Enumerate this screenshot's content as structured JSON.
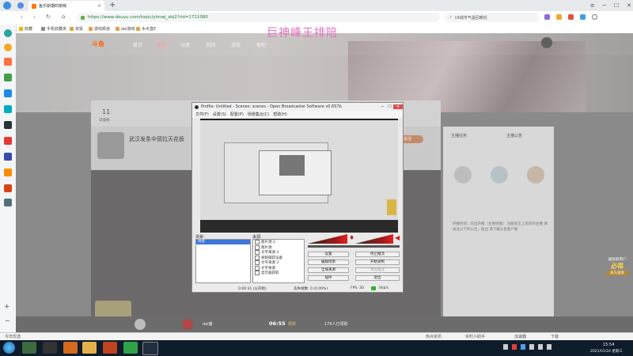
{
  "browser": {
    "tab_title": "鱼乐斯珊四弟喊",
    "new_tab": "+",
    "url": "https://www.douyu.com/topic/ylmwj_zbj2?rid=1711080",
    "search_placeholder": "19城市气温回暖低",
    "bookmarks": [
      "收藏",
      "手机收藏夹",
      "资投",
      "游戏频道",
      "dal游戏",
      "木木直E"
    ]
  },
  "overlay_banner": "巨神峰王排陪",
  "site": {
    "logo": "斗鱼",
    "nav": [
      "首页",
      "直播",
      "分类",
      "视频",
      "游戏",
      "鱼吧"
    ],
    "room": {
      "rank_label": "11",
      "rank_sub": "日排榜",
      "streamer_title": "武汉发条伞德拉天花板",
      "follow": "关注",
      "report": "举报",
      "right_tags": [
        "主播任务",
        "主播公告"
      ],
      "bottom_user": "dai酱",
      "bottom_time": "06:55",
      "bottom_time_tag": "领奖",
      "bottom_count": "176人已领取"
    },
    "announce": "开播时间：日出开播（主要周播） 贡献星王上黑的的主播 请关注以下的公告，粉丝 请下载斗鱼客户端",
    "sponsor_text": [
      "超级新用户",
      "必得",
      "永久道具"
    ]
  },
  "obs": {
    "title": "Profile: Untitled - Scenes: scenes - Open Broadcaster Software v0.657b",
    "menu": [
      "文件(F)",
      "设置(S)",
      "配置(P)",
      "场景集合(C)",
      "帮助(H)"
    ],
    "scenes_label": "场景:",
    "sources_label": "来源:",
    "scenes": [
      "场景"
    ],
    "sources": [
      "图片源 2",
      "图片源",
      "文字来源 4",
      "视频捕获设备",
      "文字来源 3",
      "文字来源",
      "显示器获取"
    ],
    "buttons_left": [
      "设置",
      "编辑场景",
      "全域来源",
      "插件"
    ],
    "buttons_right": [
      "停止推流",
      "开始录制",
      "预览推流",
      "退出"
    ],
    "status": [
      "0:00:31 (以开始)",
      "丢失帧数: 0 (0.00%)",
      "FPS: 30",
      "0kb/s"
    ]
  },
  "statusbar": {
    "left": "今日优选",
    "items": [
      "热点资讯",
      "实时小助手",
      "加速器",
      "下载"
    ],
    "time": "15:54",
    "date": "2021/01/24 星期三"
  }
}
